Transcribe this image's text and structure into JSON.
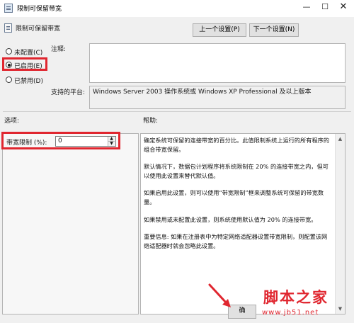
{
  "window": {
    "title": "限制可保留带宽",
    "min_glyph": "—",
    "max_glyph": "☐",
    "close_glyph": "✕"
  },
  "header": {
    "policy_name": "限制可保留带宽",
    "prev_button": "上一个设置(P)",
    "next_button": "下一个设置(N)"
  },
  "state": {
    "options": [
      {
        "label": "未配置(C)",
        "checked": false
      },
      {
        "label": "已启用(E)",
        "checked": true
      },
      {
        "label": "已禁用(D)",
        "checked": false
      }
    ]
  },
  "comment": {
    "label": "注释:",
    "value": ""
  },
  "supported": {
    "label": "支持的平台:",
    "value": "Windows Server 2003 操作系统或 Windows XP Professional 及以上版本"
  },
  "options_section": {
    "label": "选项:",
    "bandwidth_label": "带宽限制 (%):",
    "bandwidth_value": "0",
    "spin_up": "▲",
    "spin_down": "▼"
  },
  "help_section": {
    "label": "帮助:",
    "paragraphs": [
      "确定系统可保留的连接带宽的百分比。此值限制系统上运行的所有程序的组合带宽保留。",
      "默认情况下，数据包计划程序将系统限制在 20% 的连接带宽之内，但可以使用此设置来替代默认值。",
      "如果启用此设置，则可以使用“带宽限制”框来调整系统可保留的带宽数量。",
      "如果禁用或未配置此设置，则系统使用默认值为 20% 的连接带宽。",
      "重要信息: 如果在注册表中为特定网络适配器设置带宽限制，则配置该网络适配器时就会忽略此设置。"
    ],
    "scroll_up": "▲",
    "scroll_down": "▼"
  },
  "footer": {
    "ok_button": "确"
  },
  "watermark": {
    "site_name": "脚本之家",
    "url": "www.jb51.net"
  },
  "colors": {
    "highlight": "#e0262f",
    "background": "#f0f0f0"
  }
}
